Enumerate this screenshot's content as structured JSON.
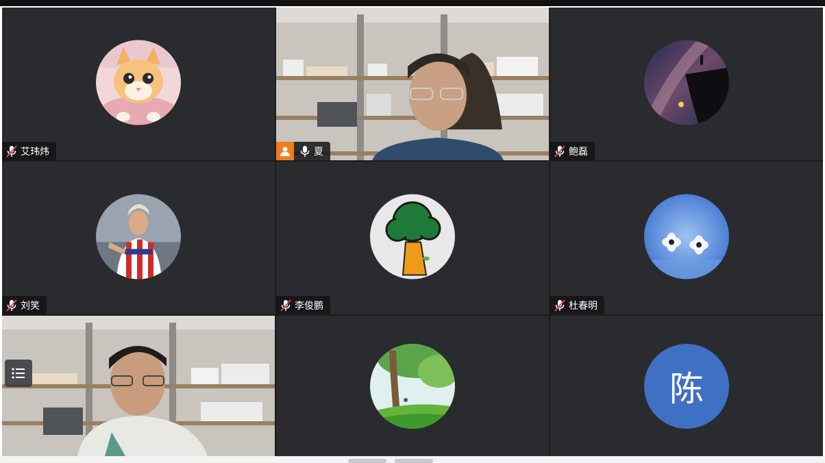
{
  "window": {
    "title": ""
  },
  "participants": [
    {
      "name": "艾玮炜",
      "muted": true,
      "avatar": "cat-photo-icon"
    },
    {
      "name": "夏",
      "muted": false,
      "host": true,
      "video": true
    },
    {
      "name": "鲍磊",
      "muted": true,
      "avatar": "milky-way-photo-icon"
    },
    {
      "name": "刘笑",
      "muted": true,
      "avatar": "soccer-player-photo-icon"
    },
    {
      "name": "李俊鹏",
      "muted": true,
      "avatar": "tree-cartoon-icon"
    },
    {
      "name": "杜春明",
      "muted": true,
      "avatar": "flowers-photo-icon"
    },
    {
      "name": "",
      "muted": false,
      "video": true,
      "active_speaker": true
    },
    {
      "name": "",
      "muted": true,
      "avatar": "meadow-tree-illustration-icon"
    },
    {
      "name": "",
      "muted": true,
      "avatar_letter": "陈"
    }
  ],
  "colors": {
    "host_badge": "#f07c1e",
    "active_border": "#2fb556",
    "letter_avatar": "#3f70c4",
    "tile_bg": "#292b2e"
  }
}
